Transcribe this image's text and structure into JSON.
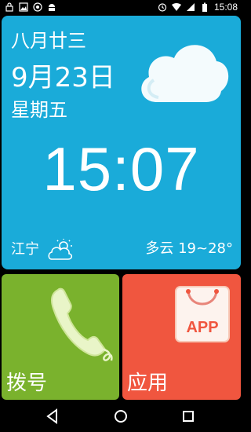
{
  "status_bar": {
    "time": "15:08",
    "icons": [
      "lock-icon",
      "image-icon",
      "signal-app-icon",
      "android-icon",
      "alarm-icon",
      "wifi-icon",
      "cellular-icon",
      "battery-icon"
    ]
  },
  "panel": {
    "lunar_date": "八月廿三",
    "date": "9月23日",
    "weekday": "星期五",
    "time": "15:07",
    "city": "江宁",
    "weather": "多云 19~28°",
    "background_color": "#1aabd9"
  },
  "tiles": [
    {
      "label": "拨号",
      "icon": "phone-icon",
      "color": "#7ab22d"
    },
    {
      "label": "应用",
      "icon": "app-store-icon",
      "color": "#f0563f",
      "icon_text": "APP"
    }
  ],
  "nav_bar": {
    "buttons": [
      "back-icon",
      "home-icon",
      "recents-icon"
    ]
  }
}
